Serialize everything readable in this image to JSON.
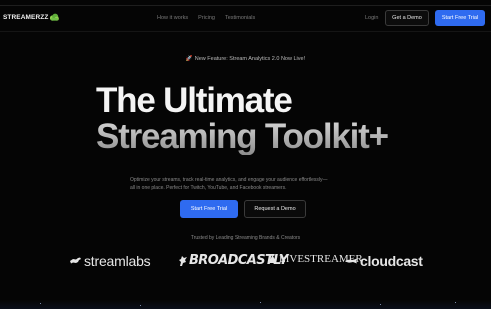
{
  "brand": {
    "name": "STREAMERZZ",
    "icon": "cloud-logo-icon",
    "accent": "#2f6bf0"
  },
  "nav": {
    "links": [
      "How it works",
      "Pricing",
      "Testimonials"
    ],
    "login": "Login",
    "demo": "Get a Demo",
    "trial": "Start Free Trial"
  },
  "hero": {
    "announcement": "New Feature: Stream Analytics 2.0 Now Live!",
    "announcement_icon": "rocket-icon",
    "title_line1": "The Ultimate",
    "title_line2": "Streaming Toolkit+",
    "subtitle_line1": "Optimize your streams, track real-time analytics, and engage your audience effortlessly—",
    "subtitle_line2": "all in one place. Perfect for Twitch, YouTube, and Facebook streamers.",
    "cta_primary": "Start Free Trial",
    "cta_secondary": "Request a Demo"
  },
  "trusted": {
    "label": "Trusted by Leading Streaming Brands & Creators",
    "logos": [
      {
        "name": "streamlabs",
        "icon": "kangaroo-icon"
      },
      {
        "name": "BROADCASTLY",
        "icon": "wolf-icon"
      },
      {
        "name": "LIVESTREAMER",
        "icon": "triangle-icon"
      },
      {
        "name": "cloudcast",
        "icon": "whale-icon"
      }
    ]
  }
}
